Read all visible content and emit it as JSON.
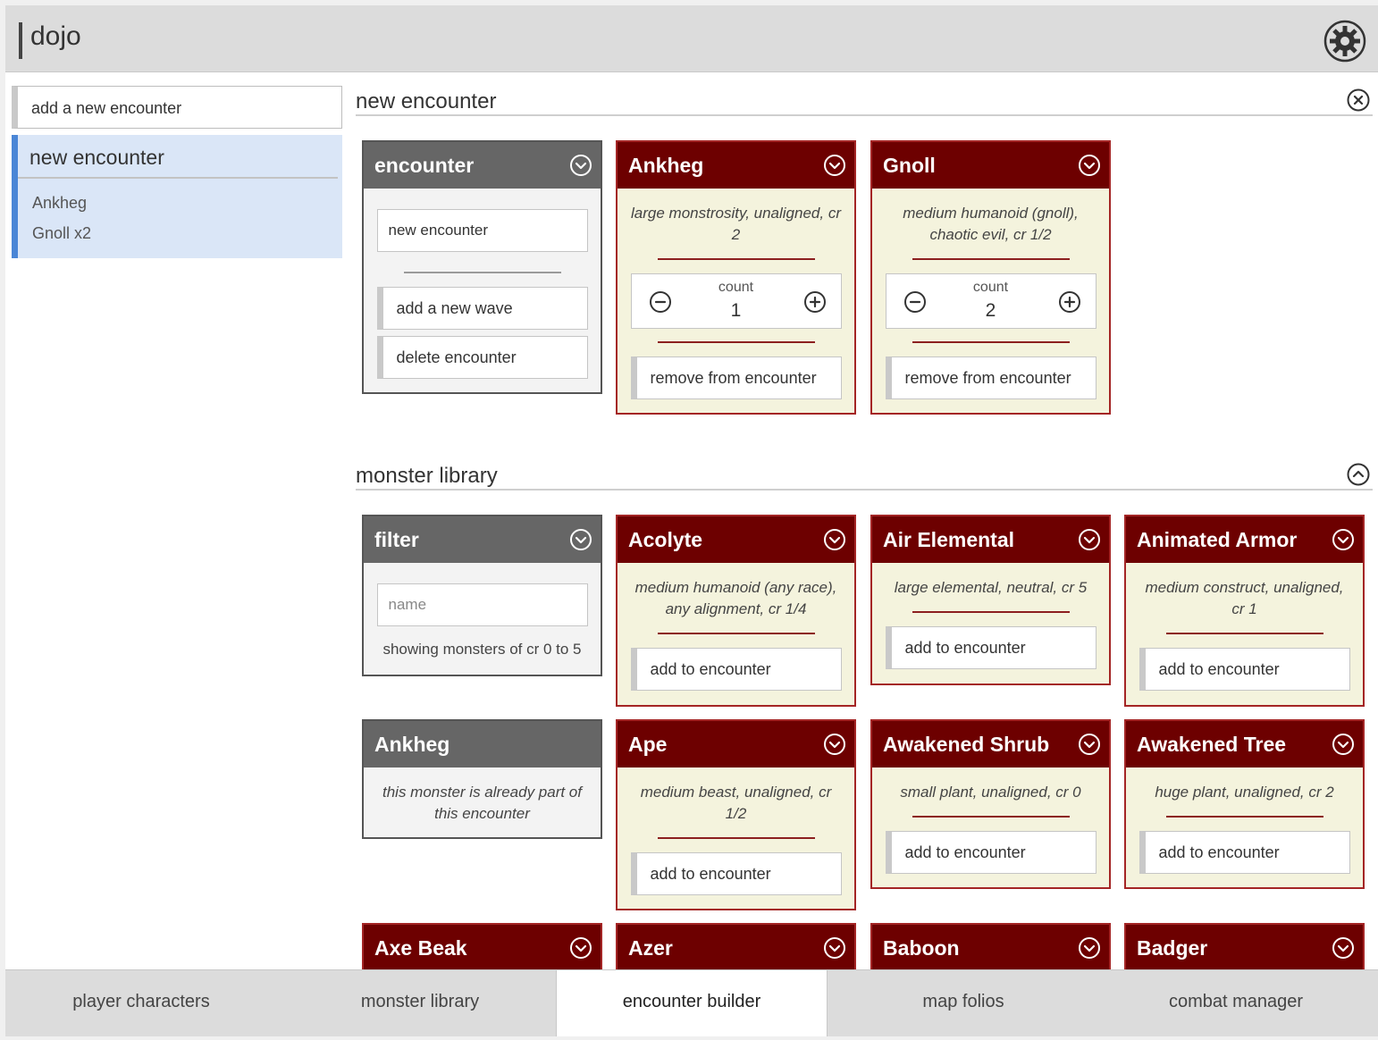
{
  "app": {
    "title": "dojo"
  },
  "sidebar": {
    "add_encounter_label": "add a new encounter",
    "encounters": [
      {
        "name": "new encounter",
        "monsters": [
          "Ankheg",
          "Gnoll x2"
        ]
      }
    ]
  },
  "encounter_section": {
    "title": "new encounter",
    "encounter_card": {
      "title": "encounter",
      "name_value": "new encounter",
      "add_wave_label": "add a new wave",
      "delete_label": "delete encounter"
    },
    "monsters": [
      {
        "name": "Ankheg",
        "desc": "large monstrosity, unaligned, cr 2",
        "count_label": "count",
        "count": "1",
        "remove_label": "remove from encounter"
      },
      {
        "name": "Gnoll",
        "desc": "medium humanoid (gnoll), chaotic evil, cr 1/2",
        "count_label": "count",
        "count": "2",
        "remove_label": "remove from encounter"
      }
    ]
  },
  "library_section": {
    "title": "monster library",
    "filter": {
      "title": "filter",
      "name_placeholder": "name",
      "info": "showing monsters of cr 0 to 5"
    },
    "already_part": {
      "name": "Ankheg",
      "message": "this monster is already part of this encounter"
    },
    "add_label": "add to encounter",
    "monsters": [
      {
        "name": "Acolyte",
        "desc": "medium humanoid (any race), any alignment, cr 1/4"
      },
      {
        "name": "Air Elemental",
        "desc": "large elemental, neutral, cr 5"
      },
      {
        "name": "Animated Armor",
        "desc": "medium construct, unaligned, cr 1"
      },
      {
        "name": "Ape",
        "desc": "medium beast, unaligned, cr 1/2"
      },
      {
        "name": "Awakened Shrub",
        "desc": "small plant, unaligned, cr 0"
      },
      {
        "name": "Awakened Tree",
        "desc": "huge plant, unaligned, cr 2"
      },
      {
        "name": "Axe Beak"
      },
      {
        "name": "Azer"
      },
      {
        "name": "Baboon"
      },
      {
        "name": "Badger"
      }
    ]
  },
  "tabs": [
    {
      "label": "player characters"
    },
    {
      "label": "monster library"
    },
    {
      "label": "encounter builder",
      "active": true
    },
    {
      "label": "map folios"
    },
    {
      "label": "combat manager"
    }
  ],
  "colors": {
    "monster_header": "#6d0000",
    "monster_body": "#f4f3dd",
    "neutral_header": "#666666",
    "sidebar_selected": "#dae6f7",
    "sidebar_accent": "#4a86d6"
  },
  "icons": {
    "settings": "gear-icon",
    "close_section": "close-circle-icon",
    "collapse_section": "chevron-up-circle-icon",
    "card_toggle": "chevron-down-circle-icon",
    "decrement": "minus-circle-icon",
    "increment": "plus-circle-icon"
  }
}
